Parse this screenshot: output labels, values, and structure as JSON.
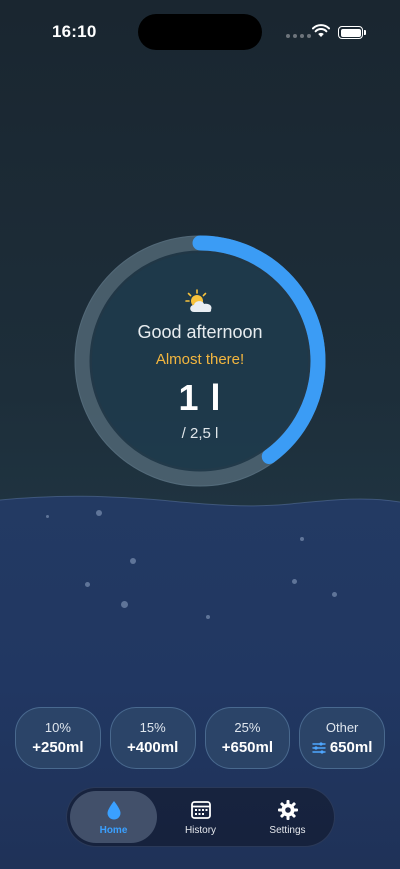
{
  "status_bar": {
    "time": "16:10"
  },
  "greeting": {
    "weather_icon": "sun-behind-cloud-icon",
    "text": "Good afternoon",
    "motivation": "Almost there!",
    "current": "1 l",
    "goal": "/ 2,5 l",
    "progress_fraction": 0.4,
    "colors": {
      "accent": "#3b9cf5",
      "motivation": "#f3b63f"
    }
  },
  "quick_add": [
    {
      "percent": "10%",
      "amount": "+250ml"
    },
    {
      "percent": "15%",
      "amount": "+400ml"
    },
    {
      "percent": "25%",
      "amount": "+650ml"
    },
    {
      "percent": "Other",
      "amount": "650ml",
      "icon": "sliders-icon"
    }
  ],
  "tab_bar": {
    "tabs": [
      {
        "label": "Home",
        "icon": "water-drop-icon",
        "active": true
      },
      {
        "label": "History",
        "icon": "calendar-icon",
        "active": false
      },
      {
        "label": "Settings",
        "icon": "gear-icon",
        "active": false
      }
    ]
  }
}
